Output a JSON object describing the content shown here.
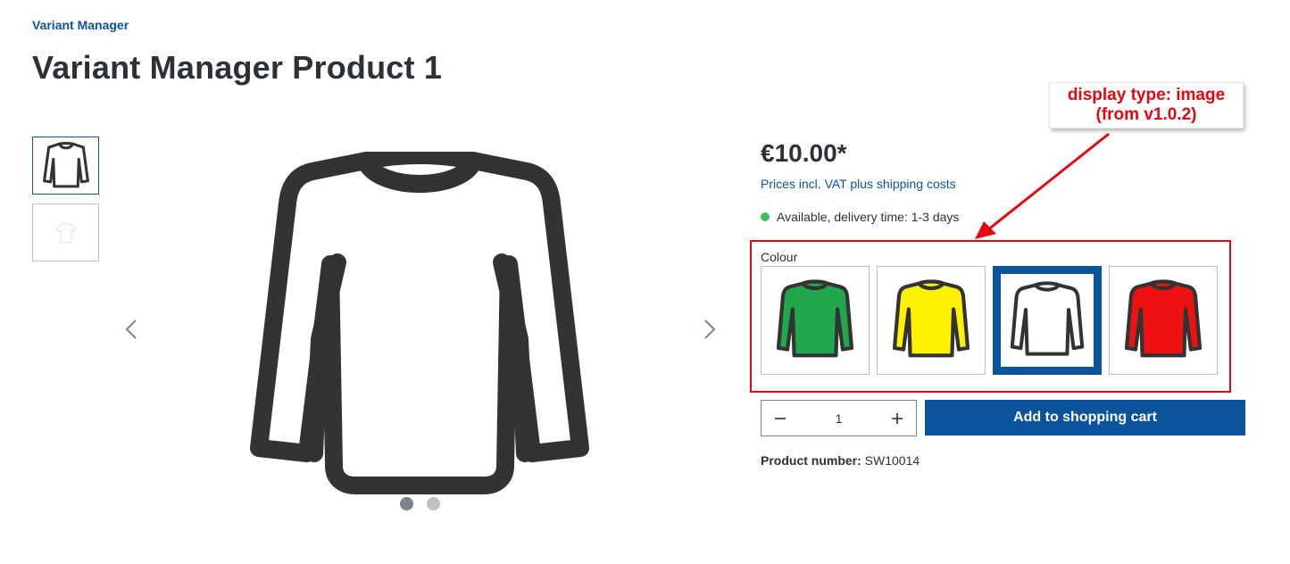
{
  "breadcrumb": "Variant Manager",
  "title": "Variant Manager Product 1",
  "price": "€10.00*",
  "tax_info": "Prices incl. VAT plus shipping costs",
  "availability": "Available, delivery time: 1-3 days",
  "colour_label": "Colour",
  "quantity": "1",
  "add_to_cart": "Add to shopping cart",
  "product_number_label": "Product number:",
  "product_number": "SW10014",
  "annotation": {
    "line1": "display type: image",
    "line2": "(from v1.0.2)"
  },
  "swatches": [
    {
      "color": "#22a84a",
      "icon": "green-shirt-icon"
    },
    {
      "color": "#fff200",
      "icon": "yellow-shirt-icon"
    },
    {
      "color": "#ffffff",
      "icon": "white-shirt-icon"
    },
    {
      "color": "#ee1111",
      "icon": "red-shirt-icon"
    }
  ],
  "colors": {
    "brand": "#0b539b",
    "annotation": "#e30613",
    "available": "#3cc261"
  }
}
